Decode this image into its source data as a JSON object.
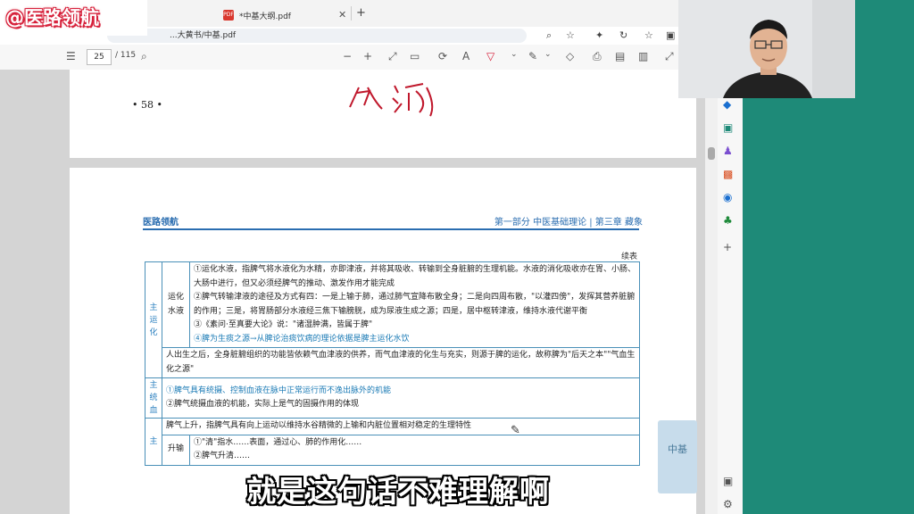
{
  "watermark": {
    "text": "@医路领航"
  },
  "browser": {
    "tab_title": "*中基大纲.pdf",
    "url": "...大黄书/中基.pdf"
  },
  "pdf_toolbar": {
    "page_current": "25",
    "page_total": "/ 115"
  },
  "page1": {
    "page_number": "• 58 •",
    "handwriting": "化液"
  },
  "page2": {
    "header_logo": "医路领航",
    "header_section": "第一部分  中医基础理论 | 第三章  藏象",
    "continued": "续表",
    "rows": {
      "yunhua_label": "主运化",
      "shuiye_label": "运化水液",
      "shuiye_1": "①运化水液，指脾气将水液化为水精，亦即津液，并将其吸收、转输到全身脏腑的生理机能。水液的消化吸收亦在胃、小肠、大肠中进行，但又必须经脾气的推动、激发作用才能完成",
      "shuiye_2": "②脾气转输津液的途径及方式有四：一是上输于肺，通过肺气宣降布散全身；二是向四周布散，\"以灌四傍\"，发挥其营养脏腑的作用；三是，将胃肠部分水液经三焦下输膀胱，成为尿液生成之源；四是，居中枢转津液，维持水液代谢平衡",
      "shuiye_3": "③《素问·至真要大论》说：\"诸湿肿满，皆属于脾\"",
      "shuiye_4": "④脾为生痰之源→从脾论治痰饮病的理论依据是脾主运化水饮",
      "houtian": "人出生之后，全身脏腑组织的功能皆依赖气血津液的供养，而气血津液的化生与充实，则源于脾的运化，故称脾为\"后天之本\"\"气血生化之源\"",
      "tongxue_label": "主统血",
      "tongxue_1": "①脾气具有统摄、控制血液在脉中正常运行而不逸出脉外的机能",
      "tongxue_2": "②脾气统摄血液的机能，实际上是气的固摄作用的体现",
      "sheng_label": "主",
      "sheng_intro": "脾气上升，指脾气具有向上运动以维持水谷精微的上输和内脏位置相对稳定的生理特性",
      "shengshu_label": "升输",
      "sheng_1": "①\"清\"指水……表面，通过心、肺的作用化……",
      "sheng_2": "②脾气升清……"
    },
    "side_note": "中基"
  },
  "subtitle": "就是这句话不难理解啊"
}
